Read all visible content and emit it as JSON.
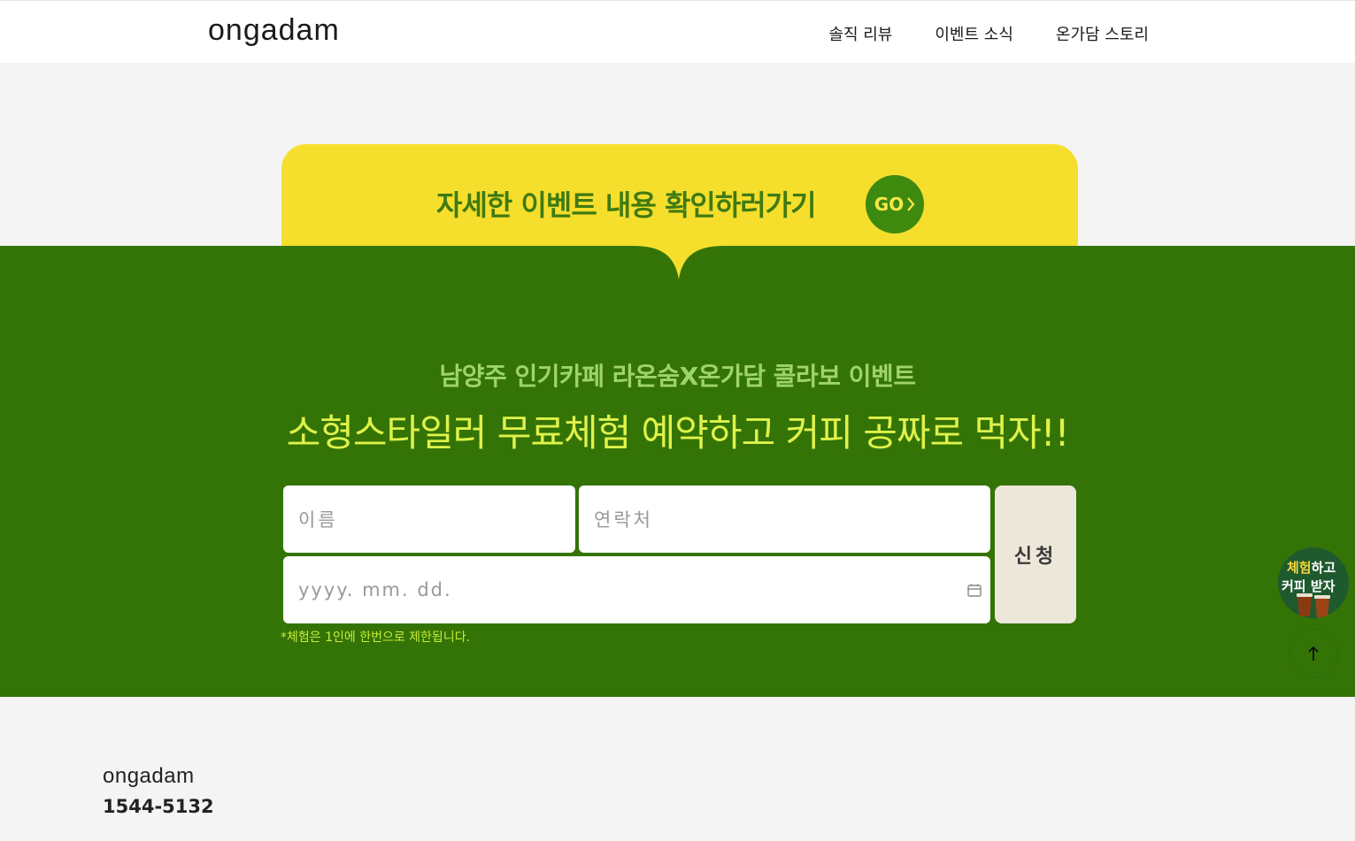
{
  "header": {
    "logo": "ongadam",
    "nav": [
      {
        "label": "솔직 리뷰"
      },
      {
        "label": "이벤트 소식"
      },
      {
        "label": "온가담 스토리"
      }
    ]
  },
  "banner": {
    "text": "자세한 이벤트 내용 확인하러가기",
    "go_label": "GO",
    "go_icon": "chevron-right-icon",
    "color": "#f5df2c"
  },
  "event": {
    "subtitle": "남양주 인기카페 라온숨X온가담 콜라보 이벤트",
    "title": "소형스타일러 무료체험 예약하고 커피 공짜로 먹자!!",
    "background_color": "#347407"
  },
  "form": {
    "name_placeholder": "이름",
    "phone_placeholder": "연락처",
    "date_placeholder": "yyyy. mm. dd.",
    "submit_label": "신청",
    "notice": "*체험은 1인에 한번으로 제한됩니다."
  },
  "floating": {
    "badge_line1_a": "체험",
    "badge_line1_b": "하고",
    "badge_line2_a": "커피",
    "badge_line2_b": "받자",
    "top_icon": "arrow-up-icon"
  },
  "footer": {
    "logo": "ongadam",
    "phone": "1544-5132"
  }
}
